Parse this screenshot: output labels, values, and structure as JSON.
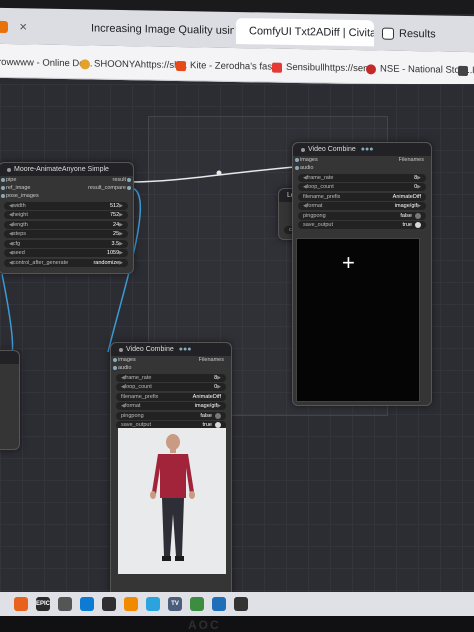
{
  "browser": {
    "tabs": [
      {
        "label": "",
        "active": false,
        "icon": "tab-favicon",
        "color": "#e8710a"
      },
      {
        "label": "Increasing Image Quality using",
        "active": false,
        "icon": "comfy-favicon",
        "color": "#1a73e8"
      },
      {
        "label": "ComfyUI Txt2ADiff | Civitai",
        "active": true,
        "icon": "civitai-favicon",
        "color": "#1a73e8"
      },
      {
        "label": "Results",
        "active": false,
        "icon": "notion-favicon",
        "color": "#333333"
      }
    ],
    "bookmarks": [
      {
        "label": "rowwww - Online De...",
        "color": ""
      },
      {
        "label": "SHOONYAhttps://sh...",
        "color": "#e3a22b"
      },
      {
        "label": "Kite - Zerodha's fast...",
        "color": "#e64a19"
      },
      {
        "label": "Sensibullhttps://sen...",
        "color": "#e53935"
      },
      {
        "label": "NSE - National Stoc...",
        "color": "#c62828"
      },
      {
        "label": "In",
        "color": "#444444"
      }
    ]
  },
  "nodes": {
    "moore": {
      "title": "Moore-AnimateAnyone Simple",
      "inputs": [
        "pipe",
        "ref_image",
        "pose_images"
      ],
      "outputs": [
        "result",
        "result_compare"
      ],
      "widgets": [
        {
          "label": "width",
          "value": "512"
        },
        {
          "label": "height",
          "value": "752"
        },
        {
          "label": "length",
          "value": "24"
        },
        {
          "label": "steps",
          "value": "25"
        },
        {
          "label": "cfg",
          "value": "3.5"
        },
        {
          "label": "seed",
          "value": "1059"
        },
        {
          "label": "control_after_generate",
          "value": "randomize"
        }
      ]
    },
    "combine_right": {
      "title": "Video Combine",
      "badge": "Filenames",
      "inputs": [
        "images",
        "audio"
      ],
      "widgets": [
        {
          "label": "frame_rate",
          "value": "8"
        },
        {
          "label": "loop_count",
          "value": "0"
        },
        {
          "label": "filename_prefix",
          "value": "AnimateDiff"
        },
        {
          "label": "format",
          "value": "image/gif"
        },
        {
          "label": "pingpong",
          "value": "false"
        },
        {
          "label": "save_output",
          "value": "true"
        }
      ]
    },
    "combine_bottom": {
      "title": "Video Combine",
      "badge": "Filenames",
      "inputs": [
        "images",
        "audio"
      ],
      "widgets": [
        {
          "label": "frame_rate",
          "value": "8"
        },
        {
          "label": "loop_count",
          "value": "0"
        },
        {
          "label": "filename_prefix",
          "value": "AnimateDiff"
        },
        {
          "label": "format",
          "value": "image/gif"
        },
        {
          "label": "pingpong",
          "value": "false"
        },
        {
          "label": "save_output",
          "value": "true"
        }
      ]
    },
    "load_partial": {
      "title": "Loa",
      "widget": "clip"
    }
  },
  "taskbar": [
    {
      "icon": "firefox-icon",
      "color": "#e8621d",
      "text": ""
    },
    {
      "icon": "epic-games-icon",
      "color": "#2b2b2b",
      "text": "EPIC"
    },
    {
      "icon": "store-icon",
      "color": "#555555",
      "text": ""
    },
    {
      "icon": "edge-icon",
      "color": "#0c7bd4",
      "text": ""
    },
    {
      "icon": "obs-icon",
      "color": "#302e31",
      "text": ""
    },
    {
      "icon": "vlc-icon",
      "color": "#f28a00",
      "text": ""
    },
    {
      "icon": "telegram-icon",
      "color": "#2aa3de",
      "text": ""
    },
    {
      "icon": "app-icon",
      "color": "#4b5d7a",
      "text": "TV"
    },
    {
      "icon": "chrome-icon",
      "color": "#3c8d3f",
      "text": ""
    },
    {
      "icon": "vscode-icon",
      "color": "#1e6fb8",
      "text": ""
    },
    {
      "icon": "terminal-icon",
      "color": "#333333",
      "text": ""
    }
  ],
  "monitor_brand": "AOC"
}
